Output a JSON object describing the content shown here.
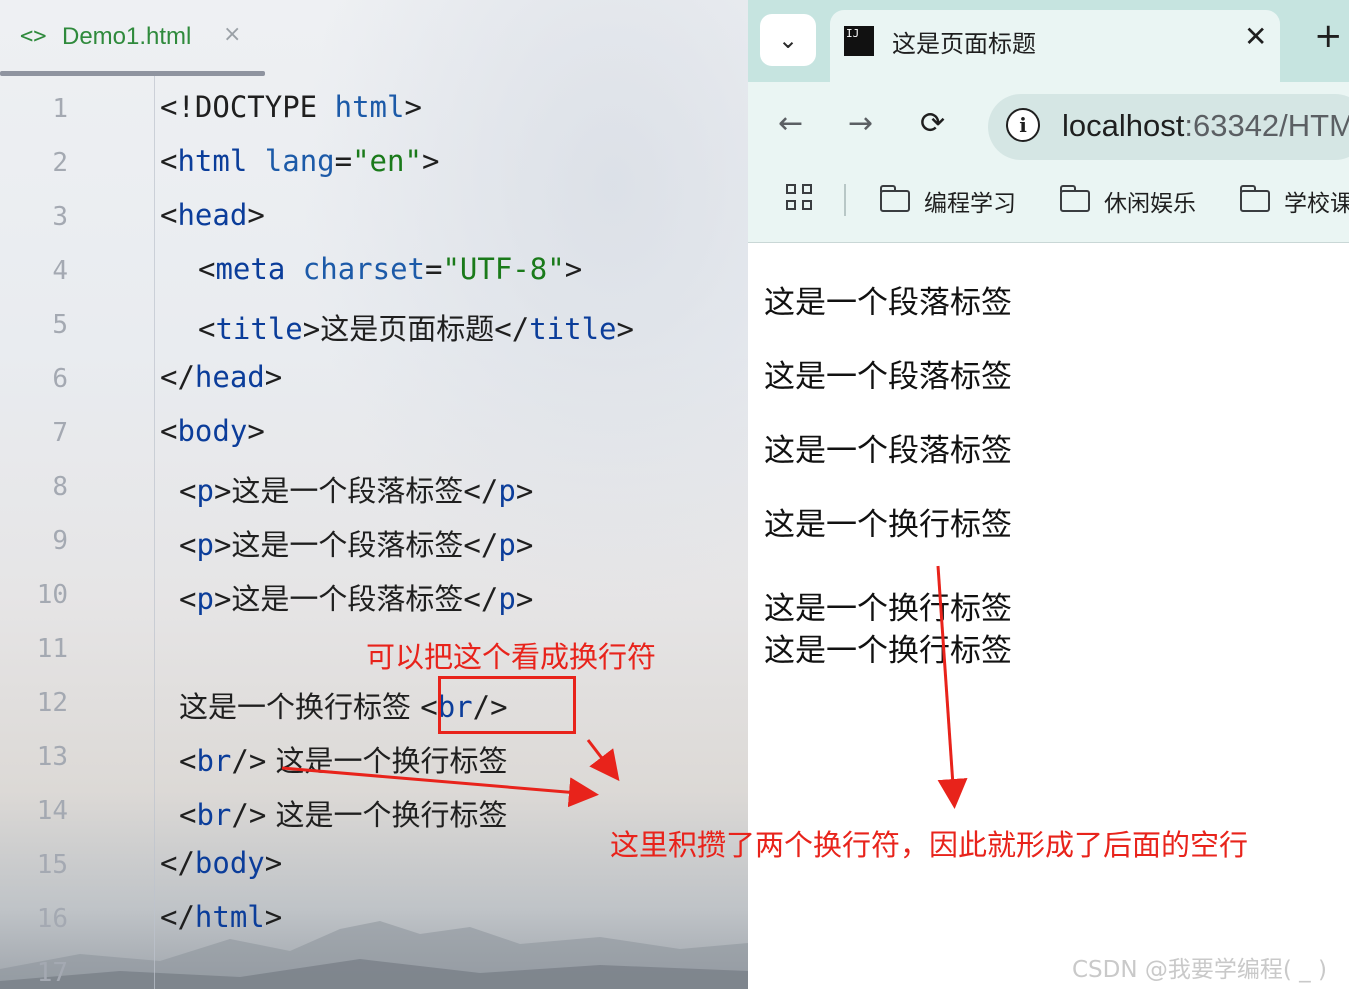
{
  "editor": {
    "tab": {
      "icon": "code-brackets-icon",
      "icon_text": "<>",
      "filename": "Demo1.html",
      "close": "×"
    },
    "line_numbers": [
      "1",
      "2",
      "3",
      "4",
      "5",
      "6",
      "7",
      "8",
      "9",
      "10",
      "11",
      "12",
      "13",
      "14",
      "15",
      "16",
      "17"
    ],
    "lines": {
      "l1": {
        "open": "<!DOCTYPE ",
        "kw": "html",
        "close": ">"
      },
      "l2": {
        "lt": "<",
        "tag": "html",
        "attr": " lang",
        "eq": "=",
        "val": "\"en\"",
        "gt": ">"
      },
      "l3": {
        "lt": "<",
        "tag": "head",
        "gt": ">"
      },
      "l4": {
        "lt": "<",
        "tag": "meta",
        "attr": " charset",
        "eq": "=",
        "val": "\"UTF-8\"",
        "gt": ">"
      },
      "l5": {
        "lt": "<",
        "tag": "title",
        "gt": ">",
        "text": "这是页面标题",
        "lt2": "</",
        "tag2": "title",
        "gt2": ">"
      },
      "l6": {
        "lt": "</",
        "tag": "head",
        "gt": ">"
      },
      "l7": {
        "lt": "<",
        "tag": "body",
        "gt": ">"
      },
      "l8": {
        "lt": "<",
        "tag": "p",
        "gt": ">",
        "text": "这是一个段落标签",
        "lt2": "</",
        "tag2": "p",
        "gt2": ">"
      },
      "l9": {
        "lt": "<",
        "tag": "p",
        "gt": ">",
        "text": "这是一个段落标签",
        "lt2": "</",
        "tag2": "p",
        "gt2": ">"
      },
      "l10": {
        "lt": "<",
        "tag": "p",
        "gt": ">",
        "text": "这是一个段落标签",
        "lt2": "</",
        "tag2": "p",
        "gt2": ">"
      },
      "l12": {
        "text": "这是一个换行标签 ",
        "lt": "<",
        "tag": "br",
        "gt": "/>"
      },
      "l13": {
        "lt": "<",
        "tag": "br",
        "gt": "/>",
        "text": " 这是一个换行标签"
      },
      "l14": {
        "lt": "<",
        "tag": "br",
        "gt": "/>",
        "text": " 这是一个换行标签"
      },
      "l15": {
        "lt": "</",
        "tag": "body",
        "gt": ">"
      },
      "l16": {
        "lt": "</",
        "tag": "html",
        "gt": ">"
      }
    }
  },
  "annotations": {
    "br_note": "可以把这个看成换行符",
    "blank_line_note": "这里积攒了两个换行符，因此就形成了后面的空行",
    "color": "#e8231b"
  },
  "browser": {
    "tab_dropdown_icon": "chevron-down-icon",
    "tab_dropdown_glyph": "⌄",
    "favicon_text": "IJ",
    "tab_title": "这是页面标题",
    "tab_close": "✕",
    "new_tab": "+",
    "back": "←",
    "forward": "→",
    "reload": "⟳",
    "info_glyph": "i",
    "url_host": "localhost",
    "url_port": ":63342/HTM",
    "bookmarks": [
      "编程学习",
      "休闲娱乐",
      "学校课"
    ],
    "paragraphs": [
      "这是一个段落标签",
      "这是一个段落标签",
      "这是一个段落标签",
      "这是一个换行标签",
      "这是一个换行标签",
      "这是一个换行标签"
    ],
    "watermark": "CSDN @我要学编程( _ )"
  }
}
